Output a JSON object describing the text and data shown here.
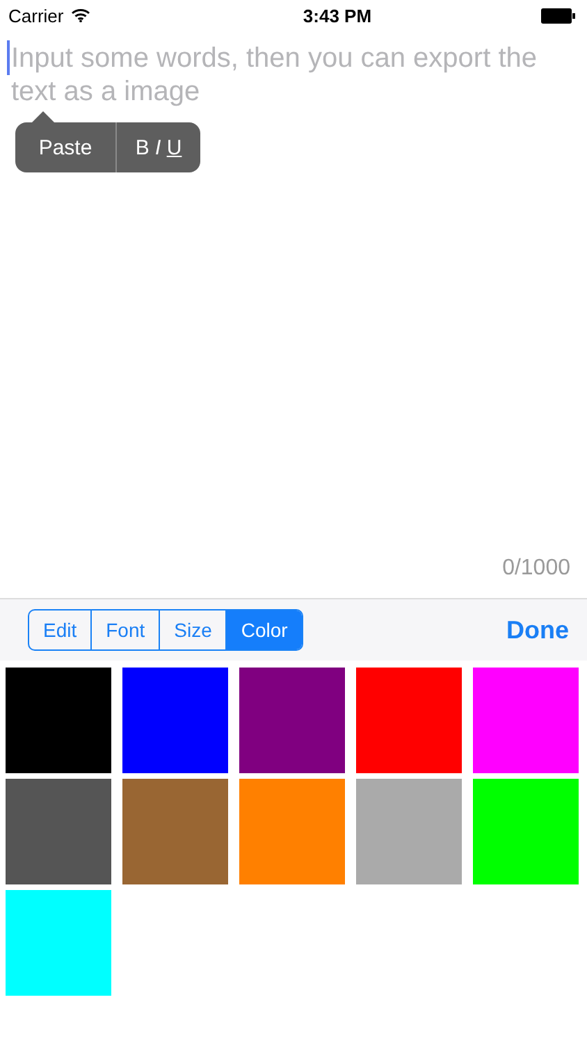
{
  "status_bar": {
    "carrier": "Carrier",
    "time": "3:43 PM"
  },
  "editor": {
    "placeholder": "Input some words, then you can export the text as a image",
    "counter": "0/1000"
  },
  "edit_menu": {
    "items": [
      {
        "kind": "text",
        "label": "Paste"
      },
      {
        "kind": "styles",
        "parts": [
          "B",
          "I",
          "U"
        ]
      }
    ]
  },
  "toolbar": {
    "segments": [
      {
        "label": "Edit",
        "selected": false
      },
      {
        "label": "Font",
        "selected": false
      },
      {
        "label": "Size",
        "selected": false
      },
      {
        "label": "Color",
        "selected": true
      }
    ],
    "done": "Done"
  },
  "swatches": [
    {
      "color": "#000000"
    },
    {
      "color": "#0000ff"
    },
    {
      "color": "#800080"
    },
    {
      "color": "#ff0000"
    },
    {
      "color": "#ff00ff"
    },
    {
      "color": "#555555"
    },
    {
      "color": "#996633"
    },
    {
      "color": "#ff8000"
    },
    {
      "color": "#aaaaaa"
    },
    {
      "color": "#00ff00"
    },
    {
      "color": "#00ffff"
    }
  ]
}
